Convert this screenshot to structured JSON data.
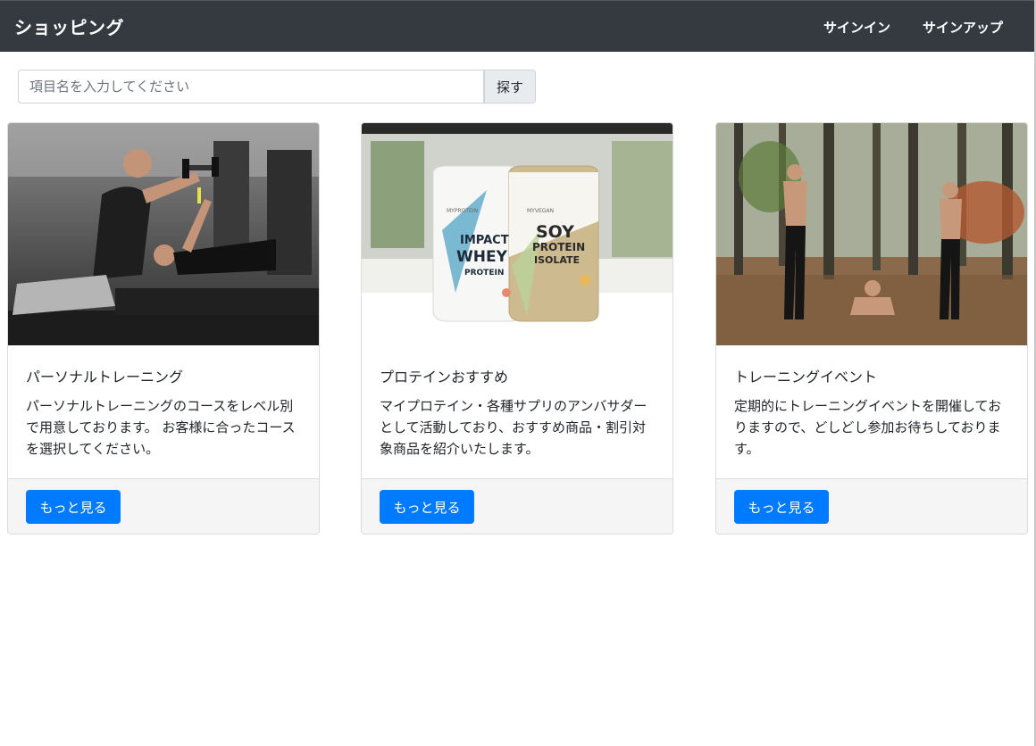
{
  "navbar": {
    "brand": "ショッピング",
    "signin": "サインイン",
    "signup": "サインアップ"
  },
  "search": {
    "placeholder": "項目名を入力してください",
    "button": "探す"
  },
  "cards": [
    {
      "title": "パーソナルトレーニング",
      "text": "パーソナルトレーニングのコースをレベル別で用意しております。 お客様に合ったコースを選択してください。",
      "button": "もっと見る"
    },
    {
      "title": "プロテインおすすめ",
      "text": "マイプロテイン・各種サプリのアンバサダーとして活動しており、おすすめ商品・割引対象商品を紹介いたします。",
      "button": "もっと見る",
      "image_text": {
        "brand_left": "MYPROTEIN",
        "brand_right": "MYVEGAN",
        "impact": "IMPACT",
        "whey": "WHEY",
        "protein": "PROTEIN",
        "soy": "SOY",
        "soy_protein": "PROTEIN",
        "isolate": "ISOLATE"
      }
    },
    {
      "title": "トレーニングイベント",
      "text": "定期的にトレーニングイベントを開催しておりますので、どしどし参加お待ちしております。",
      "button": "もっと見る"
    }
  ],
  "colors": {
    "navbar_bg": "#343a40",
    "primary": "#007bff",
    "footer_bg": "#f5f5f5"
  }
}
